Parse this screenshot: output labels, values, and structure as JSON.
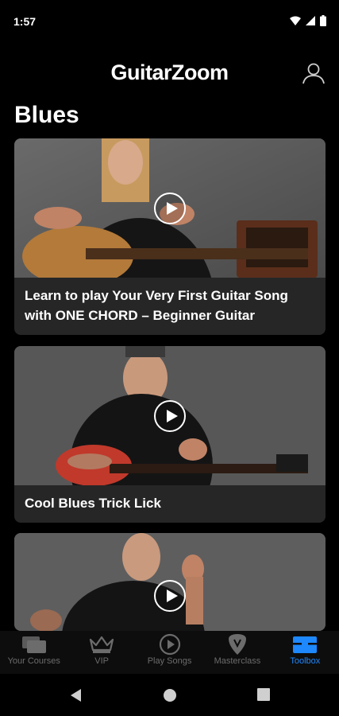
{
  "status": {
    "time": "1:57"
  },
  "header": {
    "app_title": "GuitarZoom"
  },
  "section": {
    "title": "Blues"
  },
  "cards": [
    {
      "title": "Learn to play Your Very First Guitar Song with ONE CHORD – Beginner Guitar"
    },
    {
      "title": "Cool Blues Trick Lick"
    },
    {
      "title": ""
    }
  ],
  "tabs": [
    {
      "label": "Your Courses",
      "icon": "courses-icon"
    },
    {
      "label": "VIP",
      "icon": "crown-icon"
    },
    {
      "label": "Play Songs",
      "icon": "play-circle-icon"
    },
    {
      "label": "Masterclass",
      "icon": "guitar-pick-icon"
    },
    {
      "label": "Toolbox",
      "icon": "toolbox-icon",
      "active": true
    }
  ],
  "colors": {
    "accent": "#1e88ff",
    "card_bg": "#262626",
    "background": "#000000"
  }
}
